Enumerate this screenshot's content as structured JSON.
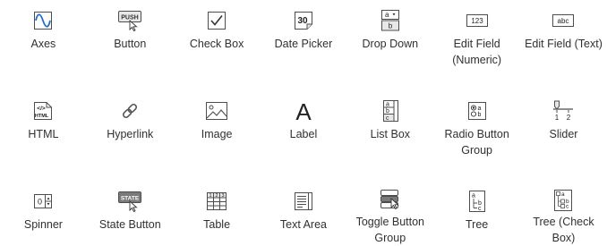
{
  "components": [
    {
      "id": "axes",
      "label": "Axes",
      "icon": "axes-icon"
    },
    {
      "id": "button",
      "label": "Button",
      "icon": "push-button-icon",
      "icon_text": "PUSH"
    },
    {
      "id": "check-box",
      "label": "Check Box",
      "icon": "check-box-icon"
    },
    {
      "id": "date-picker",
      "label": "Date Picker",
      "icon": "calendar-icon",
      "icon_text": "30"
    },
    {
      "id": "drop-down",
      "label": "Drop Down",
      "icon": "drop-down-icon",
      "icon_text_a": "a",
      "icon_text_b": "b"
    },
    {
      "id": "edit-field-numeric",
      "label": "Edit Field (Numeric)",
      "icon": "numeric-field-icon",
      "icon_text": "123"
    },
    {
      "id": "edit-field-text",
      "label": "Edit Field (Text)",
      "icon": "text-field-icon",
      "icon_text": "abc"
    },
    {
      "id": "html",
      "label": "HTML",
      "icon": "html-icon",
      "icon_text_a": "</>",
      "icon_text_b": "HTML"
    },
    {
      "id": "hyperlink",
      "label": "Hyperlink",
      "icon": "link-icon"
    },
    {
      "id": "image",
      "label": "Image",
      "icon": "image-icon"
    },
    {
      "id": "label",
      "label": "Label",
      "icon": "label-icon",
      "icon_text": "A"
    },
    {
      "id": "list-box",
      "label": "List Box",
      "icon": "list-box-icon",
      "icon_text_a": "a",
      "icon_text_b": "b",
      "icon_text_c": "c"
    },
    {
      "id": "radio-button-group",
      "label": "Radio Button Group",
      "icon": "radio-group-icon",
      "icon_text_a": "a",
      "icon_text_b": "b"
    },
    {
      "id": "slider",
      "label": "Slider",
      "icon": "slider-icon",
      "icon_text_a": "1",
      "icon_text_b": "2"
    },
    {
      "id": "spinner",
      "label": "Spinner",
      "icon": "spinner-icon",
      "icon_text": "0"
    },
    {
      "id": "state-button",
      "label": "State Button",
      "icon": "state-button-icon",
      "icon_text": "STATE"
    },
    {
      "id": "table",
      "label": "Table",
      "icon": "table-icon",
      "icon_text_a": "1",
      "icon_text_b": "2",
      "icon_text_c": "3"
    },
    {
      "id": "text-area",
      "label": "Text Area",
      "icon": "text-area-icon"
    },
    {
      "id": "toggle-button-group",
      "label": "Toggle Button Group",
      "icon": "toggle-group-icon"
    },
    {
      "id": "tree",
      "label": "Tree",
      "icon": "tree-icon",
      "icon_text_a": "a",
      "icon_text_b": "b",
      "icon_text_c": "c"
    },
    {
      "id": "tree-check-box",
      "label": "Tree (Check Box)",
      "icon": "tree-check-icon",
      "icon_text_a": "a",
      "icon_text_b": "b",
      "icon_text_c": "c"
    }
  ],
  "colors": {
    "icon_stroke": "#4d4d4d",
    "accent_blue": "#1f6fc8",
    "icon_fill": "#e8e8e8",
    "text": "#303030"
  }
}
